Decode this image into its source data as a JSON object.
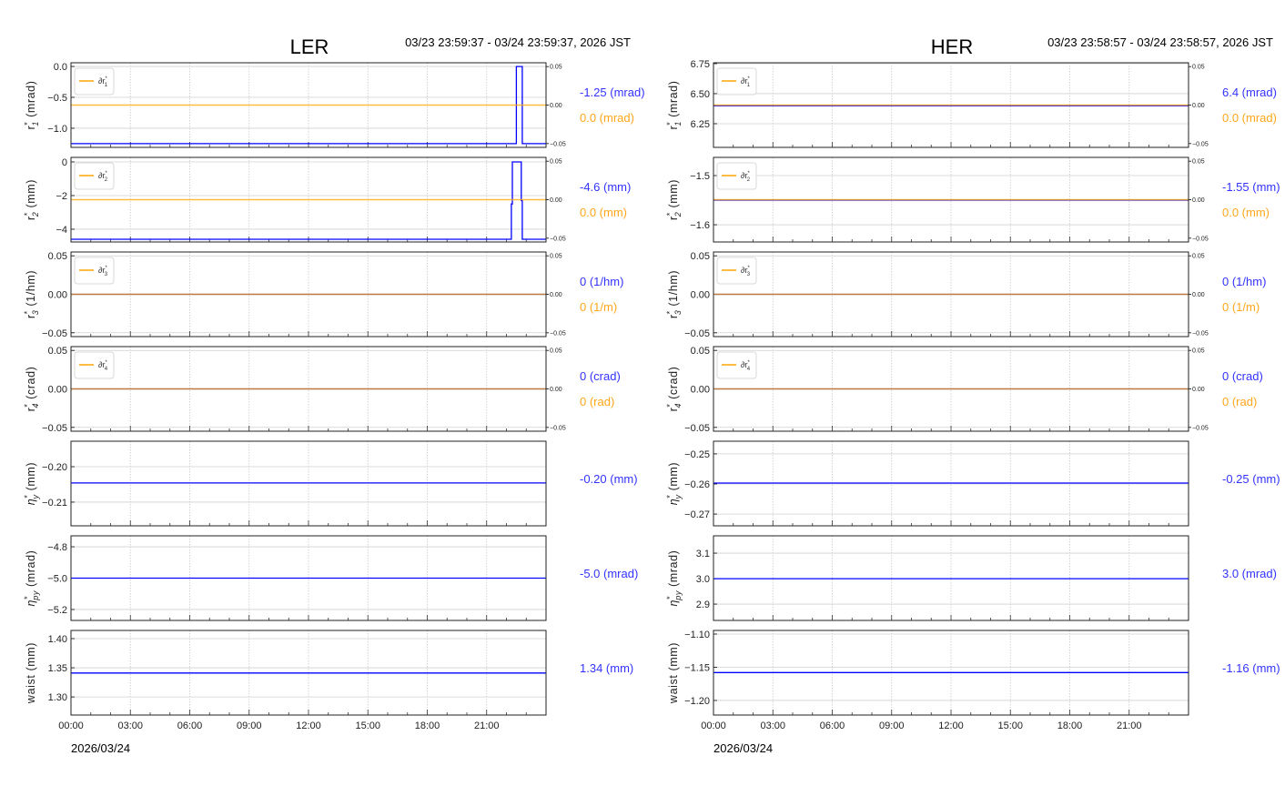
{
  "colors": {
    "value_series": "#0000ff",
    "delta_series": "#ffa500",
    "readout_value": "#3333ff",
    "readout_delta": "#ffa61a"
  },
  "chart_data": [
    {
      "type": "line",
      "title": "LER",
      "time_range": "03/23 23:59:37 - 03/24 23:59:37, 2026 JST",
      "date_label": "2026/03/24",
      "xlim_hours": [
        0,
        24
      ],
      "xticks": [
        {
          "h": 0,
          "label": "00:00"
        },
        {
          "h": 3,
          "label": "03:00"
        },
        {
          "h": 6,
          "label": "06:00"
        },
        {
          "h": 9,
          "label": "09:00"
        },
        {
          "h": 12,
          "label": "12:00"
        },
        {
          "h": 15,
          "label": "15:00"
        },
        {
          "h": 18,
          "label": "18:00"
        },
        {
          "h": 21,
          "label": "21:00"
        }
      ],
      "grid": true,
      "panels": [
        {
          "ylabel": {
            "sym": "r",
            "sup": "*",
            "sub": "1",
            "unit": " (mrad)"
          },
          "ylim": [
            -1.31,
            0.06
          ],
          "yticks": [
            {
              "v": 0.0,
              "label": "0.0"
            },
            {
              "v": -0.5,
              "label": "−0.5"
            },
            {
              "v": -1.0,
              "label": "−1.0"
            }
          ],
          "points": [
            [
              0,
              -1.25
            ],
            [
              22.5,
              -1.25
            ],
            [
              22.5,
              0.0
            ],
            [
              22.8,
              0.0
            ],
            [
              22.8,
              -1.25
            ],
            [
              24,
              -1.25
            ]
          ],
          "delta": {
            "legend": {
              "sym": "∂r",
              "sup": "*",
              "sub": "1"
            },
            "ylim": [
              -0.055,
              0.055
            ],
            "value": 0.0,
            "yticks": [
              {
                "v": 0.05,
                "label": "0.05"
              },
              {
                "v": 0,
                "label": "0.00"
              },
              {
                "v": -0.05,
                "label": "−0.05"
              }
            ]
          },
          "readout": "-1.25 (mrad)",
          "delta_readout": "0.0 (mrad)"
        },
        {
          "ylabel": {
            "sym": "r",
            "sup": "*",
            "sub": "2",
            "unit": " (mm)"
          },
          "ylim": [
            -4.76,
            0.27
          ],
          "yticks": [
            {
              "v": 0,
              "label": "0"
            },
            {
              "v": -2,
              "label": "−2"
            },
            {
              "v": -4,
              "label": "−4"
            }
          ],
          "points": [
            [
              0,
              -4.6
            ],
            [
              22.25,
              -4.6
            ],
            [
              22.25,
              -2.5
            ],
            [
              22.3,
              -2.5
            ],
            [
              22.3,
              0.0
            ],
            [
              22.75,
              0.0
            ],
            [
              22.75,
              -2.3
            ],
            [
              22.8,
              -2.3
            ],
            [
              22.8,
              -4.6
            ],
            [
              24,
              -4.6
            ]
          ],
          "delta": {
            "legend": {
              "sym": "∂r",
              "sup": "*",
              "sub": "2"
            },
            "ylim": [
              -0.055,
              0.055
            ],
            "value": 0.0,
            "yticks": [
              {
                "v": 0.05,
                "label": "0.05"
              },
              {
                "v": 0,
                "label": "0.00"
              },
              {
                "v": -0.05,
                "label": "−0.05"
              }
            ]
          },
          "readout": "-4.6 (mm)",
          "delta_readout": "0.0 (mm)"
        },
        {
          "ylabel": {
            "sym": "r",
            "sup": "*",
            "sub": "3",
            "unit": " (1/hm)"
          },
          "ylim": [
            -0.055,
            0.055
          ],
          "yticks": [
            {
              "v": 0.05,
              "label": "0.05"
            },
            {
              "v": 0,
              "label": "0.00"
            },
            {
              "v": -0.05,
              "label": "−0.05"
            }
          ],
          "points": [
            [
              0,
              0
            ],
            [
              24,
              0
            ]
          ],
          "delta": {
            "legend": {
              "sym": "∂r",
              "sup": "*",
              "sub": "3"
            },
            "ylim": [
              -0.055,
              0.055
            ],
            "value": 0.0,
            "yticks": [
              {
                "v": 0.05,
                "label": "0.05"
              },
              {
                "v": 0,
                "label": "0.00"
              },
              {
                "v": -0.05,
                "label": "−0.05"
              }
            ]
          },
          "readout": "0 (1/hm)",
          "delta_readout": "0 (1/m)"
        },
        {
          "ylabel": {
            "sym": "r",
            "sup": "*",
            "sub": "4",
            "unit": " (crad)"
          },
          "ylim": [
            -0.055,
            0.055
          ],
          "yticks": [
            {
              "v": 0.05,
              "label": "0.05"
            },
            {
              "v": 0,
              "label": "0.00"
            },
            {
              "v": -0.05,
              "label": "−0.05"
            }
          ],
          "points": [
            [
              0,
              0
            ],
            [
              24,
              0
            ]
          ],
          "delta": {
            "legend": {
              "sym": "∂r",
              "sup": "*",
              "sub": "4"
            },
            "ylim": [
              -0.055,
              0.055
            ],
            "value": 0.0,
            "yticks": [
              {
                "v": 0.05,
                "label": "0.05"
              },
              {
                "v": 0,
                "label": "0.00"
              },
              {
                "v": -0.05,
                "label": "−0.05"
              }
            ]
          },
          "readout": "0 (crad)",
          "delta_readout": "0 (rad)"
        },
        {
          "ylabel": {
            "sym": "η",
            "sup": "*",
            "sub": "y",
            "unit": " (mm)"
          },
          "ylim": [
            -0.2167,
            -0.1928
          ],
          "yticks": [
            {
              "v": -0.2,
              "label": "−0.20"
            },
            {
              "v": -0.21,
              "label": "−0.21"
            }
          ],
          "points": [
            [
              0,
              -0.2046
            ],
            [
              24,
              -0.2046
            ]
          ],
          "readout": "-0.20 (mm)"
        },
        {
          "ylabel": {
            "sym": "η",
            "sup": "*",
            "sub": "py",
            "unit": " (mrad)"
          },
          "ylim": [
            -5.27,
            -4.73
          ],
          "yticks": [
            {
              "v": -4.8,
              "label": "−4.8"
            },
            {
              "v": -5.0,
              "label": "−5.0"
            },
            {
              "v": -5.2,
              "label": "−5.2"
            }
          ],
          "points": [
            [
              0,
              -5.0
            ],
            [
              24,
              -5.0
            ]
          ],
          "readout": "-5.0 (mrad)"
        },
        {
          "ylabel": {
            "sym": "waist",
            "sup": "",
            "sub": "",
            "unit": " (mm)"
          },
          "ylim": [
            1.269,
            1.414
          ],
          "yticks": [
            {
              "v": 1.4,
              "label": "1.40"
            },
            {
              "v": 1.35,
              "label": "1.35"
            },
            {
              "v": 1.3,
              "label": "1.30"
            }
          ],
          "points": [
            [
              0,
              1.341
            ],
            [
              24,
              1.341
            ]
          ],
          "readout": "1.34 (mm)"
        }
      ]
    },
    {
      "type": "line",
      "title": "HER",
      "time_range": "03/23 23:58:57 - 03/24 23:58:57, 2026 JST",
      "date_label": "2026/03/24",
      "xlim_hours": [
        0,
        24
      ],
      "xticks": [
        {
          "h": 0,
          "label": "00:00"
        },
        {
          "h": 3,
          "label": "03:00"
        },
        {
          "h": 6,
          "label": "06:00"
        },
        {
          "h": 9,
          "label": "09:00"
        },
        {
          "h": 12,
          "label": "12:00"
        },
        {
          "h": 15,
          "label": "15:00"
        },
        {
          "h": 18,
          "label": "18:00"
        },
        {
          "h": 21,
          "label": "21:00"
        }
      ],
      "grid": true,
      "panels": [
        {
          "ylabel": {
            "sym": "r",
            "sup": "*",
            "sub": "1",
            "unit": " (mrad)"
          },
          "ylim": [
            6.053,
            6.757
          ],
          "yticks": [
            {
              "v": 6.75,
              "label": "6.75"
            },
            {
              "v": 6.5,
              "label": "6.50"
            },
            {
              "v": 6.25,
              "label": "6.25"
            }
          ],
          "points": [
            [
              0,
              6.4
            ],
            [
              24,
              6.4
            ]
          ],
          "delta": {
            "legend": {
              "sym": "∂r",
              "sup": "*",
              "sub": "1"
            },
            "ylim": [
              -0.055,
              0.055
            ],
            "value": 0.0,
            "yticks": [
              {
                "v": 0.05,
                "label": "0.05"
              },
              {
                "v": 0,
                "label": "0.00"
              },
              {
                "v": -0.05,
                "label": "−0.05"
              }
            ]
          },
          "readout": "6.4 (mrad)",
          "delta_readout": "0.0 (mrad)"
        },
        {
          "ylabel": {
            "sym": "r",
            "sup": "*",
            "sub": "2",
            "unit": " (mm)"
          },
          "ylim": [
            -1.635,
            -1.463
          ],
          "yticks": [
            {
              "v": -1.5,
              "label": "−1.5"
            },
            {
              "v": -1.6,
              "label": "−1.6"
            }
          ],
          "points": [
            [
              0,
              -1.55
            ],
            [
              24,
              -1.55
            ]
          ],
          "delta": {
            "legend": {
              "sym": "∂r",
              "sup": "*",
              "sub": "2"
            },
            "ylim": [
              -0.055,
              0.055
            ],
            "value": 0.0,
            "yticks": [
              {
                "v": 0.05,
                "label": "0.05"
              },
              {
                "v": 0,
                "label": "0.00"
              },
              {
                "v": -0.05,
                "label": "−0.05"
              }
            ]
          },
          "readout": "-1.55 (mm)",
          "delta_readout": "0.0 (mm)"
        },
        {
          "ylabel": {
            "sym": "r",
            "sup": "*",
            "sub": "3",
            "unit": " (1/hm)"
          },
          "ylim": [
            -0.055,
            0.055
          ],
          "yticks": [
            {
              "v": 0.05,
              "label": "0.05"
            },
            {
              "v": 0,
              "label": "0.00"
            },
            {
              "v": -0.05,
              "label": "−0.05"
            }
          ],
          "points": [
            [
              0,
              0
            ],
            [
              24,
              0
            ]
          ],
          "delta": {
            "legend": {
              "sym": "∂r",
              "sup": "*",
              "sub": "3"
            },
            "ylim": [
              -0.055,
              0.055
            ],
            "value": 0.0,
            "yticks": [
              {
                "v": 0.05,
                "label": "0.05"
              },
              {
                "v": 0,
                "label": "0.00"
              },
              {
                "v": -0.05,
                "label": "−0.05"
              }
            ]
          },
          "readout": "0 (1/hm)",
          "delta_readout": "0 (1/m)"
        },
        {
          "ylabel": {
            "sym": "r",
            "sup": "*",
            "sub": "4",
            "unit": " (crad)"
          },
          "ylim": [
            -0.055,
            0.055
          ],
          "yticks": [
            {
              "v": 0.05,
              "label": "0.05"
            },
            {
              "v": 0,
              "label": "0.00"
            },
            {
              "v": -0.05,
              "label": "−0.05"
            }
          ],
          "points": [
            [
              0,
              0
            ],
            [
              24,
              0
            ]
          ],
          "delta": {
            "legend": {
              "sym": "∂r",
              "sup": "*",
              "sub": "4"
            },
            "ylim": [
              -0.055,
              0.055
            ],
            "value": 0.0,
            "yticks": [
              {
                "v": 0.05,
                "label": "0.05"
              },
              {
                "v": 0,
                "label": "0.00"
              },
              {
                "v": -0.05,
                "label": "−0.05"
              }
            ]
          },
          "readout": "0 (crad)",
          "delta_readout": "0 (rad)"
        },
        {
          "ylabel": {
            "sym": "η",
            "sup": "*",
            "sub": "y",
            "unit": " (mm)"
          },
          "ylim": [
            -0.2739,
            -0.2458
          ],
          "yticks": [
            {
              "v": -0.25,
              "label": "−0.25"
            },
            {
              "v": -0.26,
              "label": "−0.26"
            },
            {
              "v": -0.27,
              "label": "−0.27"
            }
          ],
          "points": [
            [
              0,
              -0.2597
            ],
            [
              24,
              -0.2597
            ]
          ],
          "readout": "-0.25 (mm)"
        },
        {
          "ylabel": {
            "sym": "η",
            "sup": "*",
            "sub": "py",
            "unit": " (mrad)"
          },
          "ylim": [
            2.836,
            3.168
          ],
          "yticks": [
            {
              "v": 3.1,
              "label": "3.1"
            },
            {
              "v": 3.0,
              "label": "3.0"
            },
            {
              "v": 2.9,
              "label": "2.9"
            }
          ],
          "points": [
            [
              0,
              3.0
            ],
            [
              24,
              3.0
            ]
          ],
          "readout": "3.0 (mrad)"
        },
        {
          "ylabel": {
            "sym": "waist",
            "sup": "",
            "sub": "",
            "unit": " (mm)"
          },
          "ylim": [
            -1.222,
            -1.0945
          ],
          "yticks": [
            {
              "v": -1.1,
              "label": "−1.10"
            },
            {
              "v": -1.15,
              "label": "−1.15"
            },
            {
              "v": -1.2,
              "label": "−1.20"
            }
          ],
          "points": [
            [
              0,
              -1.158
            ],
            [
              24,
              -1.158
            ]
          ],
          "readout": "-1.16 (mm)"
        }
      ]
    }
  ]
}
